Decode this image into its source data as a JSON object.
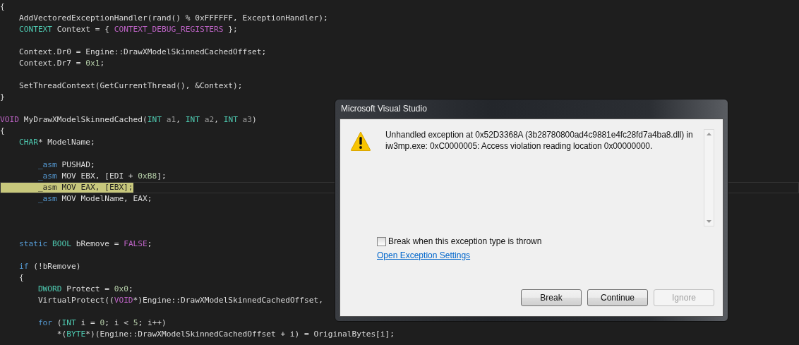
{
  "code_lines": [
    {
      "highlighted": false,
      "tokens": [
        {
          "kind": "plain",
          "text": "{"
        }
      ]
    },
    {
      "highlighted": false,
      "tokens": [
        {
          "kind": "plain",
          "text": "    AddVectoredExceptionHandler(rand() % 0xFFFFFF, ExceptionHandler);"
        }
      ]
    },
    {
      "highlighted": false,
      "tokens": [
        {
          "kind": "type",
          "text": "    CONTEXT"
        },
        {
          "kind": "plain",
          "text": " Context = { "
        },
        {
          "kind": "macro",
          "text": "CONTEXT_DEBUG_REGISTERS"
        },
        {
          "kind": "plain",
          "text": " };"
        }
      ]
    },
    {
      "highlighted": false
    },
    {
      "highlighted": false,
      "tokens": [
        {
          "kind": "plain",
          "text": "    Context.Dr0 = Engine::DrawXModelSkinnedCachedOffset;"
        }
      ]
    },
    {
      "highlighted": false,
      "tokens": [
        {
          "kind": "plain",
          "text": "    Context.Dr7 = "
        },
        {
          "kind": "number",
          "text": "0x1"
        },
        {
          "kind": "plain",
          "text": ";"
        }
      ]
    },
    {
      "highlighted": false
    },
    {
      "highlighted": false,
      "tokens": [
        {
          "kind": "plain",
          "text": "    SetThreadContext(GetCurrentThread(), &Context);"
        }
      ]
    },
    {
      "highlighted": false,
      "tokens": [
        {
          "kind": "plain",
          "text": "}"
        }
      ]
    },
    {
      "highlighted": false
    },
    {
      "highlighted": false,
      "tokens": [
        {
          "kind": "macro",
          "text": "VOID"
        },
        {
          "kind": "plain",
          "text": " MyDrawXModelSkinnedCached("
        },
        {
          "kind": "type",
          "text": "INT"
        },
        {
          "kind": "param",
          "text": " a1"
        },
        {
          "kind": "plain",
          "text": ", "
        },
        {
          "kind": "type",
          "text": "INT"
        },
        {
          "kind": "param",
          "text": " a2"
        },
        {
          "kind": "plain",
          "text": ", "
        },
        {
          "kind": "type",
          "text": "INT"
        },
        {
          "kind": "param",
          "text": " a3"
        },
        {
          "kind": "plain",
          "text": ")"
        }
      ]
    },
    {
      "highlighted": false,
      "tokens": [
        {
          "kind": "plain",
          "text": "{"
        }
      ]
    },
    {
      "highlighted": false,
      "tokens": [
        {
          "kind": "type",
          "text": "    CHAR"
        },
        {
          "kind": "plain",
          "text": "* ModelName;"
        }
      ]
    },
    {
      "highlighted": false
    },
    {
      "highlighted": false,
      "tokens": [
        {
          "kind": "keyword",
          "text": "        _asm"
        },
        {
          "kind": "plain",
          "text": " PUSHAD;"
        }
      ]
    },
    {
      "highlighted": false,
      "tokens": [
        {
          "kind": "keyword",
          "text": "        _asm"
        },
        {
          "kind": "plain",
          "text": " MOV EBX, [EDI + "
        },
        {
          "kind": "number",
          "text": "0xB8"
        },
        {
          "kind": "plain",
          "text": "];"
        }
      ]
    },
    {
      "highlighted": true,
      "tokens": [
        {
          "kind": "keyword",
          "text": "        _asm"
        },
        {
          "kind": "plain",
          "text": " MOV EAX, [EBX];"
        }
      ]
    },
    {
      "highlighted": false,
      "tokens": [
        {
          "kind": "keyword",
          "text": "        _asm"
        },
        {
          "kind": "plain",
          "text": " MOV ModelName, EAX;"
        }
      ]
    },
    {
      "highlighted": false
    },
    {
      "highlighted": false
    },
    {
      "highlighted": false
    },
    {
      "highlighted": false,
      "tokens": [
        {
          "kind": "keyword",
          "text": "    static"
        },
        {
          "kind": "type",
          "text": " BOOL"
        },
        {
          "kind": "plain",
          "text": " bRemove = "
        },
        {
          "kind": "macro",
          "text": "FALSE"
        },
        {
          "kind": "plain",
          "text": ";"
        }
      ]
    },
    {
      "highlighted": false
    },
    {
      "highlighted": false,
      "tokens": [
        {
          "kind": "keyword",
          "text": "    if"
        },
        {
          "kind": "plain",
          "text": " (!bRemove)"
        }
      ]
    },
    {
      "highlighted": false,
      "tokens": [
        {
          "kind": "plain",
          "text": "    {"
        }
      ]
    },
    {
      "highlighted": false,
      "tokens": [
        {
          "kind": "type",
          "text": "        DWORD"
        },
        {
          "kind": "plain",
          "text": " Protect = "
        },
        {
          "kind": "number",
          "text": "0x0"
        },
        {
          "kind": "plain",
          "text": ";"
        }
      ]
    },
    {
      "highlighted": false,
      "tokens": [
        {
          "kind": "plain",
          "text": "        VirtualProtect(("
        },
        {
          "kind": "macro",
          "text": "VOID"
        },
        {
          "kind": "plain",
          "text": "*)Engine::DrawXModelSkinnedCachedOffset,"
        }
      ]
    },
    {
      "highlighted": false
    },
    {
      "highlighted": false,
      "tokens": [
        {
          "kind": "keyword",
          "text": "        for"
        },
        {
          "kind": "plain",
          "text": " ("
        },
        {
          "kind": "type",
          "text": "INT"
        },
        {
          "kind": "plain",
          "text": " i = "
        },
        {
          "kind": "number",
          "text": "0"
        },
        {
          "kind": "plain",
          "text": "; i < "
        },
        {
          "kind": "number",
          "text": "5"
        },
        {
          "kind": "plain",
          "text": "; i++)"
        }
      ]
    },
    {
      "highlighted": false,
      "tokens": [
        {
          "kind": "plain",
          "text": "            *("
        },
        {
          "kind": "type",
          "text": "BYTE"
        },
        {
          "kind": "plain",
          "text": "*)(Engine::DrawXModelSkinnedCachedOffset + i) = OriginalBytes[i];"
        }
      ]
    }
  ],
  "dialog": {
    "title": "Microsoft Visual Studio",
    "message": "Unhandled exception at 0x52D3368A (3b28780800ad4c9881e4fc28fd7a4ba8.dll) in iw3mp.exe: 0xC0000005: Access violation reading location 0x00000000.",
    "checkbox": {
      "label": "Break when this exception type is thrown",
      "checked": false
    },
    "link": "Open Exception Settings",
    "buttons": [
      {
        "label": "Break",
        "disabled": false
      },
      {
        "label": "Continue",
        "disabled": false
      },
      {
        "label": "Ignore",
        "disabled": true
      }
    ]
  }
}
